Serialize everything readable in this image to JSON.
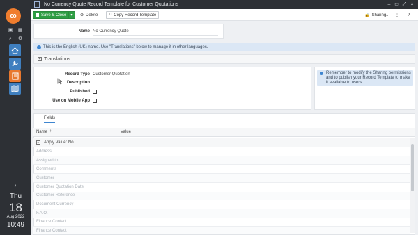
{
  "window": {
    "title": "No Currency Quote Record Template for Customer Quotations"
  },
  "toolbar": {
    "save_close": "Save & Close",
    "delete": "Delete",
    "copy": "Copy Record Template",
    "sharing": "Sharing..."
  },
  "header_form": {
    "name_label": "Name",
    "name_value": "No Currency Quote"
  },
  "info_bar": {
    "text": "This is the English (UK) name. Use \"Translations\" below to manage it in other languages."
  },
  "translations": {
    "label": "Translations"
  },
  "details": {
    "record_type_label": "Record Type",
    "record_type_value": "Customer Quotation",
    "description_label": "Description",
    "published_label": "Published",
    "mobile_label": "Use on Mobile App"
  },
  "note": {
    "text": "Remember to modify the Sharing permissions and to publish your Record Template to make it available to users."
  },
  "fields_panel": {
    "tab": "Fields",
    "col_name": "Name",
    "col_value": "Value",
    "group_label": "Apply Value: No",
    "rows": [
      "Address",
      "Assigned to",
      "Comments",
      "Customer",
      "Customer Quotation Date",
      "Customer Reference",
      "Document Currency",
      "F.A.O.",
      "Finance Contact",
      "Finance Contact"
    ]
  },
  "clock": {
    "day": "Thu",
    "date": "18",
    "month_year": "Aug 2022",
    "time": "10:49"
  },
  "colors": {
    "accent_green": "#2f9e44",
    "rail": "#2d3035",
    "logo_orange": "#f07d2e",
    "info_blue": "#dbe7f5"
  }
}
